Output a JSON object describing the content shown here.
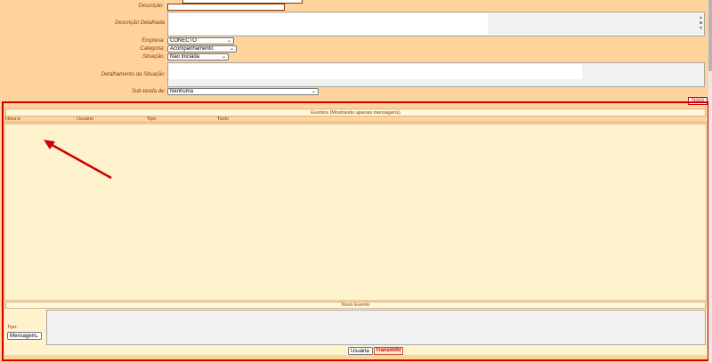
{
  "form": {
    "descricao_label": "Descrição:",
    "descricao_value": "",
    "descricao_detalhada_label": "Descrição Detalhada",
    "empresa_label": "Empresa:",
    "empresa_value": "CONECTO",
    "categoria_label": "Categoria:",
    "categoria_value": "Acompanhamento",
    "situacao_label": "Situação:",
    "situacao_value": "Não iniciada",
    "detalhamento_label": "Detalhamento da Situação:",
    "subtarefa_label": "Sub-tarefa de:",
    "subtarefa_value": "Nenhuma"
  },
  "novo_button": "Novo",
  "eventos": {
    "title": "Eventos  (Mostrando apenas mensagens)",
    "columns": [
      "Hora",
      "Usuário",
      "Tipo",
      "Texto"
    ]
  },
  "novo_evento": {
    "title": "Novo Evento",
    "tipo_label": "Tipo:",
    "tipo_value": "Mensagem",
    "recipient_value": "Usuário",
    "transmit_label": "Transmitir"
  },
  "colors": {
    "panel": "#ffd39b",
    "highlight": "#cc0000",
    "events_bg": "#fff3cd",
    "text": "#8b3a00"
  },
  "icons": {
    "sort": "sort-down-icon",
    "annotation": "red-arrow"
  }
}
